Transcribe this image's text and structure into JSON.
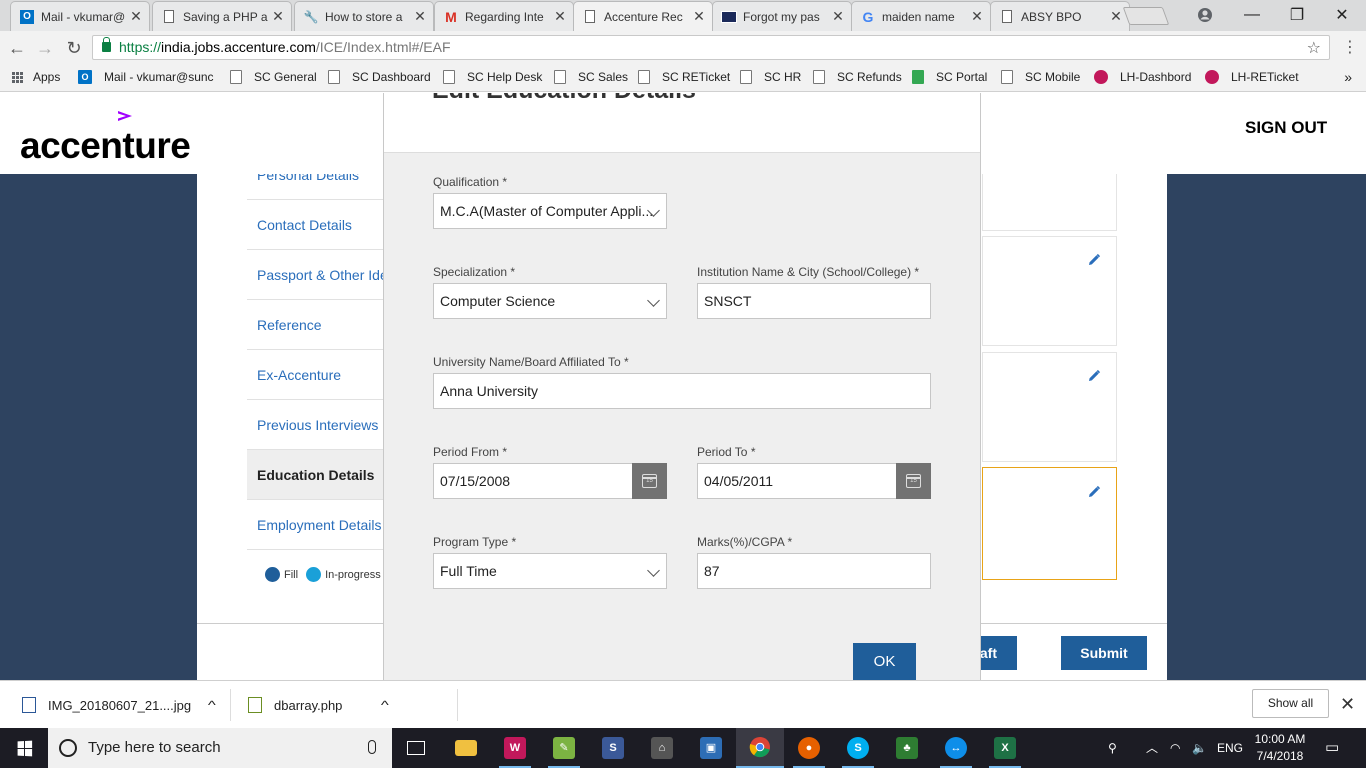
{
  "browser": {
    "tabs": [
      {
        "title": "Mail - vkumar@",
        "icon": "outlook-icon",
        "active": false
      },
      {
        "title": "Saving a PHP a",
        "icon": "page-icon",
        "active": false
      },
      {
        "title": "How to store a",
        "icon": "tools-icon",
        "active": false
      },
      {
        "title": "Regarding Inte",
        "icon": "gmail-icon",
        "active": false
      },
      {
        "title": "Accenture Rec",
        "icon": "page-icon",
        "active": true
      },
      {
        "title": "Forgot my pas",
        "icon": "flag-icon",
        "active": false
      },
      {
        "title": "maiden name",
        "icon": "google-icon",
        "active": false
      },
      {
        "title": "ABSY BPO",
        "icon": "page-icon",
        "active": false
      }
    ],
    "url": {
      "scheme": "https://",
      "host": "india.jobs.accenture.com",
      "path": "/ICE/Index.html#/EAF"
    },
    "bookmarks": [
      {
        "label": "Apps",
        "icon": "apps-icon"
      },
      {
        "label": "Mail - vkumar@sunc",
        "icon": "outlook-icon"
      },
      {
        "label": "SC General",
        "icon": "page-icon"
      },
      {
        "label": "SC Dashboard",
        "icon": "page-icon"
      },
      {
        "label": "SC Help Desk",
        "icon": "page-icon"
      },
      {
        "label": "SC Sales",
        "icon": "page-icon"
      },
      {
        "label": "SC RETicket",
        "icon": "page-icon"
      },
      {
        "label": "SC HR",
        "icon": "page-icon"
      },
      {
        "label": "SC Refunds",
        "icon": "page-icon"
      },
      {
        "label": "SC Portal",
        "icon": "green-icon"
      },
      {
        "label": "SC Mobile",
        "icon": "page-icon"
      },
      {
        "label": "LH-Dashbord",
        "icon": "lh-icon"
      },
      {
        "label": "LH-RETicket",
        "icon": "lh-icon"
      }
    ],
    "bookmarks_more": "»"
  },
  "site": {
    "logo_text": "accenture",
    "sign_out": "SIGN OUT",
    "nav": [
      {
        "label": "Personal Details",
        "active": false
      },
      {
        "label": "Contact Details",
        "active": false
      },
      {
        "label": "Passport & Other Ide",
        "active": false
      },
      {
        "label": "Reference",
        "active": false
      },
      {
        "label": "Ex-Accenture",
        "active": false
      },
      {
        "label": "Previous Interviews",
        "active": false
      },
      {
        "label": "Education Details",
        "active": true
      },
      {
        "label": "Employment Details",
        "active": false
      }
    ],
    "legend": {
      "fill": "Fill",
      "in_progress": "In-progress"
    },
    "draft_label": "aft",
    "submit_label": "Submit"
  },
  "modal": {
    "title": "Edit Education Details",
    "qualification": {
      "label": "Qualification *",
      "value": "M.C.A(Master of Computer Appli..."
    },
    "specialization": {
      "label": "Specialization *",
      "value": "Computer Science"
    },
    "institution": {
      "label": "Institution Name & City (School/College) *",
      "value": "SNSCT"
    },
    "university": {
      "label": "University Name/Board Affiliated To *",
      "value": "Anna University"
    },
    "period_from": {
      "label": "Period From *",
      "value": "07/15/2008"
    },
    "period_to": {
      "label": "Period To *",
      "value": "04/05/2011"
    },
    "program_type": {
      "label": "Program Type *",
      "value": "Full Time"
    },
    "marks": {
      "label": "Marks(%)/CGPA *",
      "value": "87"
    },
    "calendar_day": "15",
    "ok_label": "OK"
  },
  "downloads": {
    "items": [
      {
        "name": "IMG_20180607_21....jpg"
      },
      {
        "name": "dbarray.php"
      }
    ],
    "show_all": "Show all"
  },
  "taskbar": {
    "search_placeholder": "Type here to search",
    "language": "ENG",
    "time": "10:00 AM",
    "date": "7/4/2018"
  },
  "colors": {
    "accent_blue": "#1f5e9a",
    "link_blue": "#2a6ebb",
    "page_navy": "#2e4360",
    "accenture_mark": "#a100ff",
    "card_highlight": "#e8a317"
  }
}
